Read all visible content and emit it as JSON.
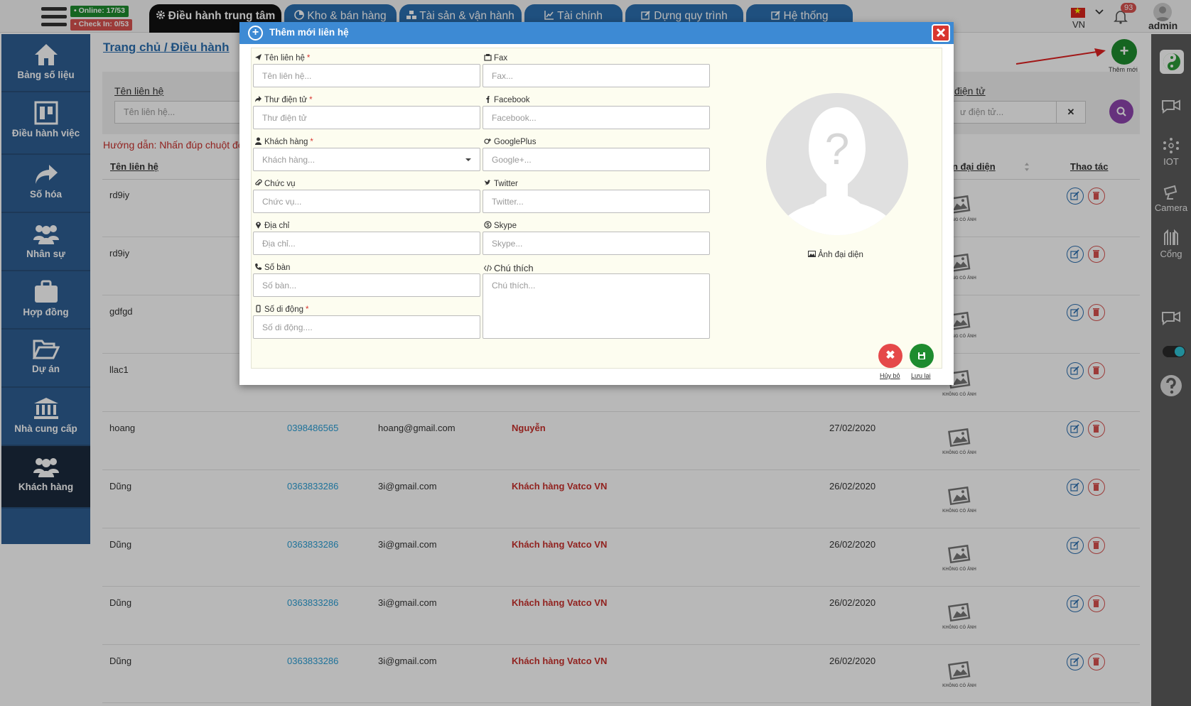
{
  "topbar": {
    "online": "• Online: 17/53",
    "checkin": "• Check In: 0/53",
    "tabs": [
      {
        "label": "Điều hành trung tâm",
        "icon": "gear-icon"
      },
      {
        "label": "Kho & bán hàng",
        "icon": "pie-chart-icon"
      },
      {
        "label": "Tài sản & vận hành",
        "icon": "cubes-icon"
      },
      {
        "label": "Tài chính",
        "icon": "line-chart-icon"
      },
      {
        "label": "Dựng quy trình",
        "icon": "edit-icon"
      },
      {
        "label": "Hệ thống",
        "icon": "edit-icon"
      }
    ],
    "language": "VN",
    "notification_count": "93",
    "user": "admin"
  },
  "sidebar": {
    "items": [
      {
        "label": "Bảng số liệu",
        "icon": "home-icon"
      },
      {
        "label": "Điều hành việc",
        "icon": "columns-icon"
      },
      {
        "label": "Số hóa",
        "icon": "share-arrow-icon"
      },
      {
        "label": "Nhân sự",
        "icon": "users-icon"
      },
      {
        "label": "Hợp đồng",
        "icon": "briefcase-icon"
      },
      {
        "label": "Dự án",
        "icon": "folder-open-icon"
      },
      {
        "label": "Nhà cung cấp",
        "icon": "bank-icon"
      },
      {
        "label": "Khách hàng",
        "icon": "users-icon"
      }
    ],
    "active": "Khách hàng"
  },
  "right_sidebar": {
    "items": [
      {
        "label": "",
        "icon": "video-chat-icon"
      },
      {
        "label": "IOT",
        "icon": "iot-icon"
      },
      {
        "label": "Camera",
        "icon": "camera-icon"
      },
      {
        "label": "Cổng",
        "icon": "gate-icon"
      },
      {
        "label": "",
        "icon": "video-chat-icon"
      },
      {
        "label": "",
        "icon": "help-icon"
      }
    ]
  },
  "page": {
    "breadcrumb": "Trang chủ / Điều hành",
    "add_label": "Thêm mới",
    "guide": "Hướng dẫn: Nhấn đúp chuột để",
    "filters": {
      "name_label": "Tên liên hệ",
      "name_placeholder": "Tên liên hệ...",
      "email_label": "điện tử",
      "email_placeholder": "ư điện tử..."
    }
  },
  "table": {
    "headers": [
      "Tên liên hệ",
      "n đại diện",
      "Thao tác"
    ],
    "no_image_text": "KHÔNG CÓ ẢNH",
    "rows": [
      {
        "name": "rd9iy",
        "phone": "",
        "email": "",
        "customer": "",
        "date": ""
      },
      {
        "name": "rd9iy",
        "phone": "",
        "email": "",
        "customer": "",
        "date": ""
      },
      {
        "name": "gdfgd",
        "phone": "",
        "email": "",
        "customer": "",
        "date": ""
      },
      {
        "name": "llac1",
        "phone": "",
        "email": "",
        "customer": "",
        "date": ""
      },
      {
        "name": "hoang",
        "phone": "0398486565",
        "email": "hoang@gmail.com",
        "customer": "Nguyễn",
        "date": "27/02/2020"
      },
      {
        "name": "Dũng",
        "phone": "0363833286",
        "email": "3i@gmail.com",
        "customer": "Khách hàng Vatco VN",
        "date": "26/02/2020"
      },
      {
        "name": "Dũng",
        "phone": "0363833286",
        "email": "3i@gmail.com",
        "customer": "Khách hàng Vatco VN",
        "date": "26/02/2020"
      },
      {
        "name": "Dũng",
        "phone": "0363833286",
        "email": "3i@gmail.com",
        "customer": "Khách hàng Vatco VN",
        "date": "26/02/2020"
      },
      {
        "name": "Dũng",
        "phone": "0363833286",
        "email": "3i@gmail.com",
        "customer": "Khách hàng Vatco VN",
        "date": "26/02/2020"
      }
    ]
  },
  "modal": {
    "title": "Thêm mới liên hệ",
    "fields_left": [
      {
        "label": "Tên liên hệ",
        "placeholder": "Tên liên hệ...",
        "required": "*",
        "icon": "paper-plane-icon"
      },
      {
        "label": "Thư điện tử",
        "placeholder": "Thư điện tử",
        "required": "*",
        "icon": "share-icon"
      },
      {
        "label": "Khách hàng",
        "placeholder": "Khách hàng...",
        "required": "*",
        "icon": "user-icon"
      },
      {
        "label": "Chức vụ",
        "placeholder": "Chức vụ...",
        "required": "",
        "icon": "paperclip-icon"
      },
      {
        "label": "Địa chỉ",
        "placeholder": "Địa chỉ...",
        "required": "",
        "icon": "map-marker-icon"
      },
      {
        "label": "Số bàn",
        "placeholder": "Số bàn...",
        "required": "",
        "icon": "phone-icon"
      },
      {
        "label": "Số di động",
        "placeholder": "Số di động....",
        "required": "*",
        "icon": "mobile-icon"
      }
    ],
    "fields_right": [
      {
        "label": "Fax",
        "placeholder": "Fax...",
        "icon": "fax-icon"
      },
      {
        "label": "Facebook",
        "placeholder": "Facebook...",
        "icon": "facebook-icon"
      },
      {
        "label": "GooglePlus",
        "placeholder": "Google+...",
        "icon": "google-plus-icon"
      },
      {
        "label": "Twitter",
        "placeholder": "Twitter...",
        "icon": "twitter-icon"
      },
      {
        "label": "Skype",
        "placeholder": "Skype...",
        "icon": "skype-icon"
      }
    ],
    "note_label": "Chú thích",
    "note_placeholder": "Chú thích...",
    "avatar_label": "Ảnh đại diện",
    "cancel_label": "Hủy bỏ",
    "save_label": "Lưu lại"
  },
  "colors": {
    "tab_blue": "#2b6fb0",
    "sidebar_blue": "#2e5f94",
    "modal_head": "#3d8ad4",
    "danger": "#d9362f",
    "success": "#1e8c2f",
    "link": "#2a9fd6"
  }
}
